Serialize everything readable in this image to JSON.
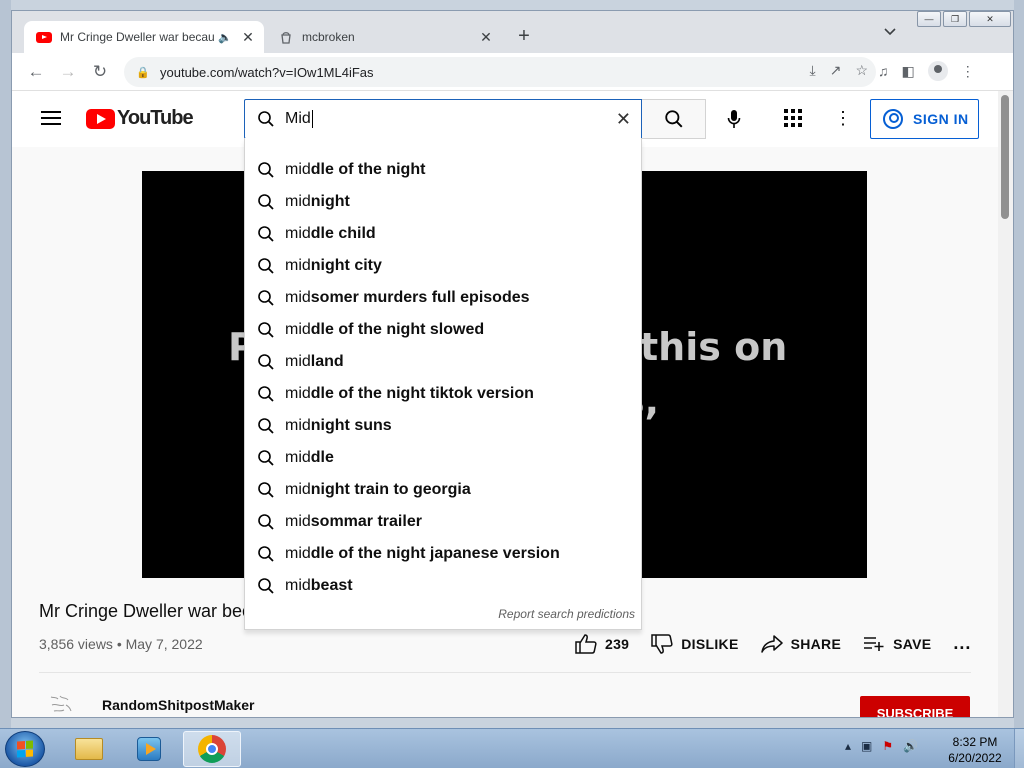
{
  "browser": {
    "tabs": [
      {
        "title": "Mr Cringe Dweller war becau",
        "active": true,
        "favicon": "youtube-icon",
        "audio": true
      },
      {
        "title": "mcbroken",
        "active": false,
        "favicon": "page-icon"
      }
    ],
    "address": "youtube.com/watch?v=IOw1ML4iFas"
  },
  "youtube": {
    "logo_text": "YouTube",
    "search_value": "Mid",
    "sign_in_label": "SIGN IN",
    "suggestions": [
      {
        "prefix": "mid",
        "rest": "dle of the night"
      },
      {
        "prefix": "mid",
        "rest": "night"
      },
      {
        "prefix": "mid",
        "rest": "dle child"
      },
      {
        "prefix": "mid",
        "rest": "night city"
      },
      {
        "prefix": "mid",
        "rest": "somer murders full episodes"
      },
      {
        "prefix": "mid",
        "rest": "dle of the night slowed"
      },
      {
        "prefix": "mid",
        "rest": "land"
      },
      {
        "prefix": "mid",
        "rest": "dle of the night tiktok version"
      },
      {
        "prefix": "mid",
        "rest": "night suns"
      },
      {
        "prefix": "mid",
        "rest": "dle"
      },
      {
        "prefix": "mid",
        "rest": "night train to georgia"
      },
      {
        "prefix": "mid",
        "rest": "sommar trailer"
      },
      {
        "prefix": "mid",
        "rest": "dle of the night japanese version"
      },
      {
        "prefix": "mid",
        "rest": "beast"
      }
    ],
    "report_label": "Report search predictions"
  },
  "video": {
    "overlay_left": "P",
    "overlay_right": "this on",
    "overlay_right2": "s,",
    "title": "Mr Cringe Dweller war bec",
    "meta": "3,856 views • May 7, 2022",
    "likes": "239",
    "dislike_label": "DISLIKE",
    "share_label": "SHARE",
    "save_label": "SAVE",
    "more_label": "...",
    "channel": "RandomShitpostMaker",
    "subscribe_label": "SUBSCRIBE"
  },
  "taskbar": {
    "time": "8:32 PM",
    "date": "6/20/2022"
  },
  "colors": {
    "brand_red": "#ff0000",
    "link_blue": "#065fd4",
    "subscribe_red": "#cc0000"
  }
}
